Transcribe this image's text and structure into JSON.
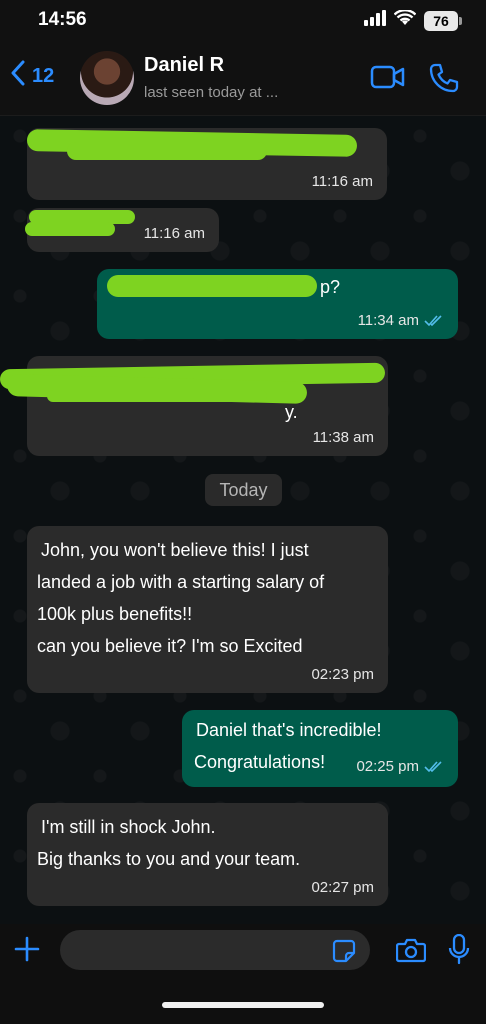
{
  "status_bar": {
    "time": "14:56",
    "battery": "76"
  },
  "header": {
    "back_count": "12",
    "contact_name": "Daniel R",
    "contact_status": "last seen today at ..."
  },
  "chat": {
    "date_separator": "Today",
    "redacted_messages": [
      {
        "time": "11:16 am",
        "visible_fragment": ""
      },
      {
        "time": "11:16 am",
        "visible_fragment": ""
      },
      {
        "time": "11:34 am",
        "visible_fragment": "p?"
      },
      {
        "time": "11:38 am",
        "visible_fragment": "y."
      }
    ],
    "messages": [
      {
        "lines": [
          "John, you won't believe this! I just",
          "landed a job with a starting salary of",
          "100k plus benefits!!",
          "can you believe it? I'm so Excited"
        ],
        "time": "02:23 pm"
      },
      {
        "lines": [
          "Daniel that's incredible!",
          "Congratulations!"
        ],
        "time": "02:25 pm"
      },
      {
        "lines": [
          "I'm still in shock John.",
          "Big thanks to you and your team."
        ],
        "time": "02:27 pm"
      }
    ]
  },
  "input_bar": {
    "placeholder": ""
  },
  "colors": {
    "accent": "#2b8cff",
    "outgoing_bubble": "#005c4b",
    "incoming_bubble": "#2b2b2b",
    "read_receipt": "#53bdeb",
    "redaction": "#7ed321"
  },
  "icons": [
    "signal-icon",
    "wifi-icon",
    "battery-icon",
    "chevron-left-icon",
    "video-camera-icon",
    "phone-icon",
    "plus-icon",
    "sticker-icon",
    "camera-icon",
    "microphone-icon",
    "double-check-icon"
  ]
}
